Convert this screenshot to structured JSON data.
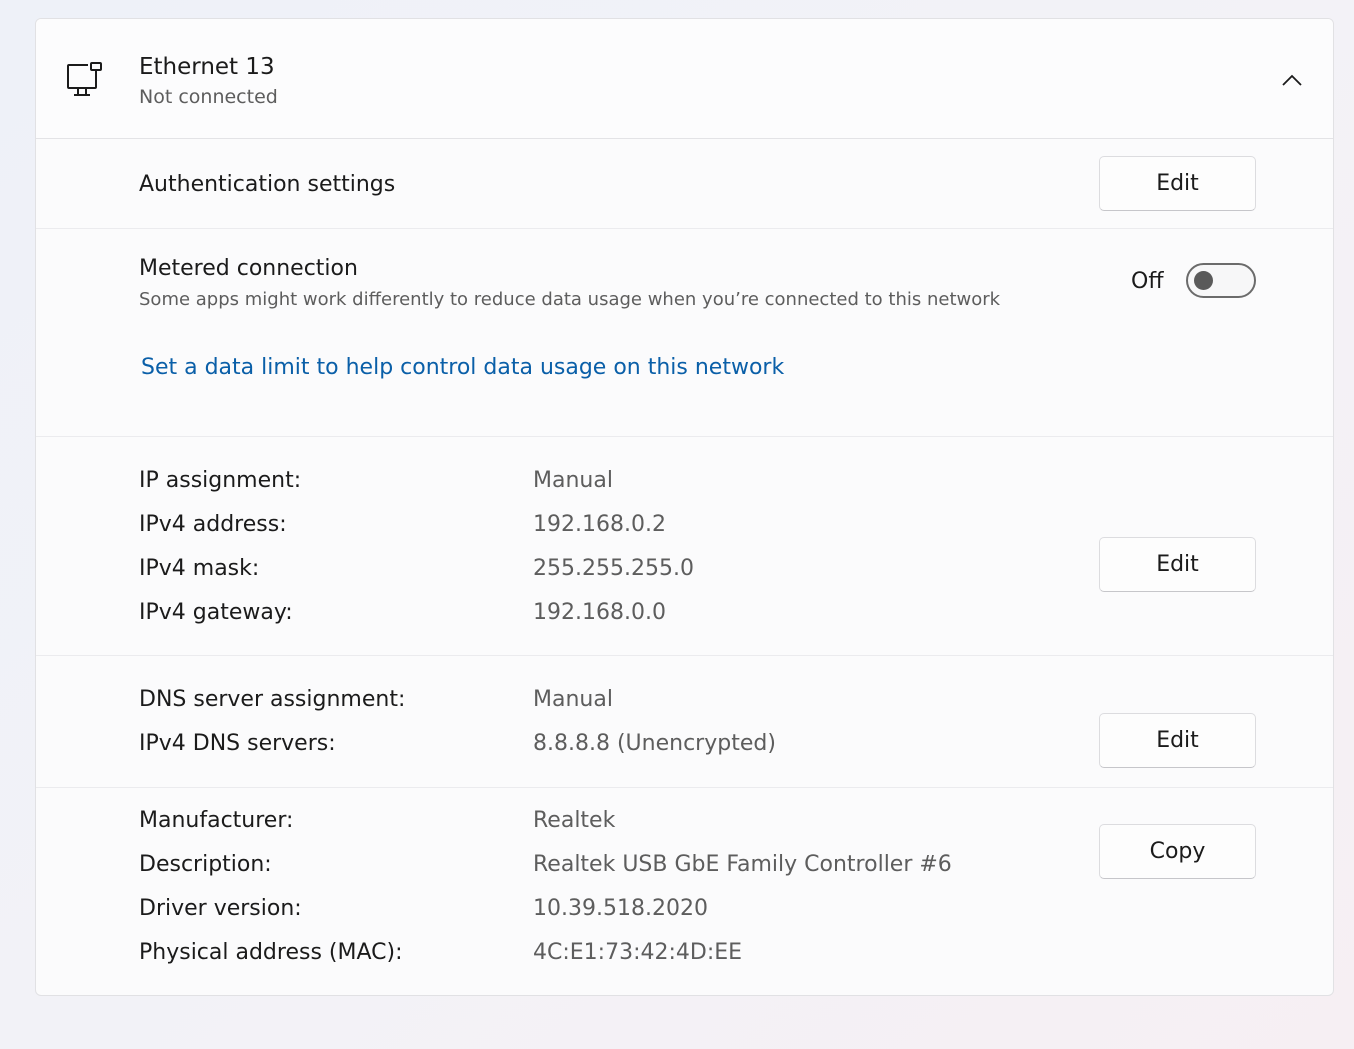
{
  "header": {
    "title": "Ethernet 13",
    "status": "Not connected",
    "icon": "ethernet-pc-icon",
    "chevron_icon": "chevron-up-icon"
  },
  "auth": {
    "label": "Authentication settings",
    "button": "Edit"
  },
  "metered": {
    "label": "Metered connection",
    "description": "Some apps might work differently to reduce data usage when you’re connected to this network",
    "toggle_state": "Off",
    "link": "Set a data limit to help control data usage on this network"
  },
  "ip": {
    "button": "Edit",
    "rows": [
      {
        "label": "IP assignment:",
        "value": "Manual"
      },
      {
        "label": "IPv4 address:",
        "value": "192.168.0.2"
      },
      {
        "label": "IPv4 mask:",
        "value": "255.255.255.0"
      },
      {
        "label": "IPv4 gateway:",
        "value": "192.168.0.0"
      }
    ]
  },
  "dns": {
    "button": "Edit",
    "rows": [
      {
        "label": "DNS server assignment:",
        "value": "Manual"
      },
      {
        "label": "IPv4 DNS servers:",
        "value": "8.8.8.8 (Unencrypted)"
      }
    ]
  },
  "hardware": {
    "button": "Copy",
    "rows": [
      {
        "label": "Manufacturer:",
        "value": "Realtek"
      },
      {
        "label": "Description:",
        "value": "Realtek USB GbE Family Controller #6"
      },
      {
        "label": "Driver version:",
        "value": "10.39.518.2020"
      },
      {
        "label": "Physical address (MAC):",
        "value": "4C:E1:73:42:4D:EE"
      }
    ]
  },
  "colors": {
    "link": "#0a5fa8",
    "secondary_text": "#5d5d5d",
    "card_background": "#fbfbfc"
  }
}
